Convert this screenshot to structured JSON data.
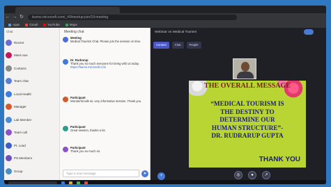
{
  "browser": {
    "url": "teams.microsoft.com/_#/l/meetup-join/19:meeting",
    "bookmarks": [
      {
        "label": "Apps",
        "color": "#5f9be0"
      },
      {
        "label": "Gmail",
        "color": "#e8453c"
      },
      {
        "label": "YouTube",
        "color": "#ff0000"
      },
      {
        "label": "Maps",
        "color": "#34a853"
      }
    ]
  },
  "rail": {
    "header": "Chat",
    "items": [
      {
        "label": "Recent",
        "color": "#6b6bd6"
      },
      {
        "label": "Meet now",
        "color": "#c2185b"
      },
      {
        "label": "Contacts",
        "color": "#888"
      },
      {
        "label": "Team chat",
        "color": "#5b7fd6"
      },
      {
        "label": "Local Health",
        "color": "#3d7be0"
      },
      {
        "label": "Manager",
        "color": "#d35a2a"
      },
      {
        "label": "Lab Member",
        "color": "#4c8bd9"
      },
      {
        "label": "Team call",
        "color": "#8a54c8"
      },
      {
        "label": "Pt. Lead",
        "color": "#3d5fc4"
      },
      {
        "label": "PS Members",
        "color": "#6d4fc2"
      },
      {
        "label": "Group",
        "color": "#4a90c2"
      }
    ]
  },
  "chat": {
    "title": "Meeting chat",
    "messages": [
      {
        "name": "Meeting",
        "text": "Medical Tourism Chat. Please join the session on time.",
        "color": "#4c6fd6"
      },
      {
        "name": "Dr. Rudrarup",
        "text": "Thank you so much everyone for being with us today.",
        "color": "#3f7bd6",
        "link": "https://teams.microsoft.com"
      },
      {
        "name": "Participant",
        "text": "Wonderful talk sir, very informative session. Thank you.",
        "color": "#d35a2a"
      },
      {
        "name": "Participant",
        "text": "Great session, thanks a lot.",
        "color": "#2f9c8e"
      },
      {
        "name": "Participant",
        "text": "Thank you so much sir.",
        "color": "#8a54c8"
      }
    ],
    "compose_placeholder": "Type a new message"
  },
  "meeting": {
    "title": "Webinar on Medical Tourism",
    "chips": [
      {
        "label": "Content",
        "active": true
      },
      {
        "label": "Chat",
        "active": false
      },
      {
        "label": "People",
        "active": false
      }
    ]
  },
  "slide": {
    "heading": "THE OVERALL MESSAGE",
    "quote_lines": [
      "“MEDICAL TOURISM IS",
      "THE DESTINY TO",
      "DETERMINE OUR",
      "HUMAN STRUCTURE”-",
      "DR. RUDRARUP GUPTA"
    ],
    "thanks": "THANK YOU"
  },
  "icons": {
    "back": "←",
    "forward": "→",
    "reload": "↻",
    "send": "➤",
    "mic": "🎙",
    "camera": "●",
    "share": "↗",
    "fab": "+"
  }
}
